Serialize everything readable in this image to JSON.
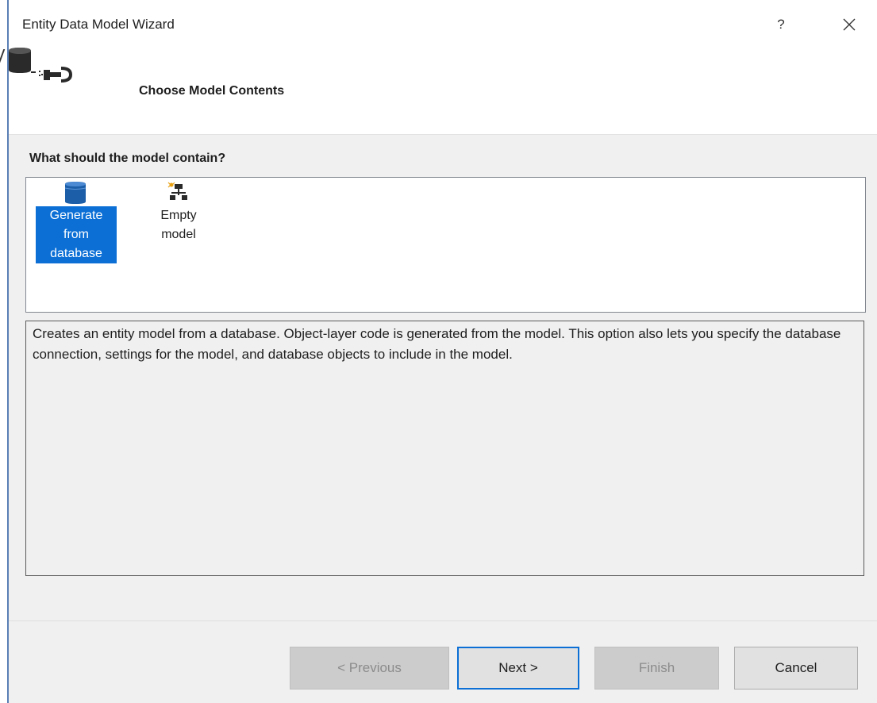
{
  "window": {
    "title": "Entity Data Model Wizard",
    "help_label": "?",
    "close_icon": "close-icon"
  },
  "header": {
    "icon": "database-plug-icon",
    "title": "Choose Model Contents"
  },
  "question": "What should the model contain?",
  "options": [
    {
      "icon": "database-icon",
      "lines": [
        "Generate",
        "from",
        "database"
      ],
      "selected": true
    },
    {
      "icon": "empty-model-icon",
      "lines": [
        "Empty",
        "model"
      ],
      "selected": false
    }
  ],
  "description": "Creates an entity model from a database. Object-layer code is generated from the model. This option also lets you specify the database connection, settings for the model, and database objects to include in the model.",
  "buttons": {
    "previous": "< Previous",
    "next": "Next >",
    "finish": "Finish",
    "cancel": "Cancel"
  },
  "colors": {
    "selection": "#0b6fd6",
    "focus_border": "#0b6fd6",
    "dialog_bg": "#f0f0f0"
  }
}
